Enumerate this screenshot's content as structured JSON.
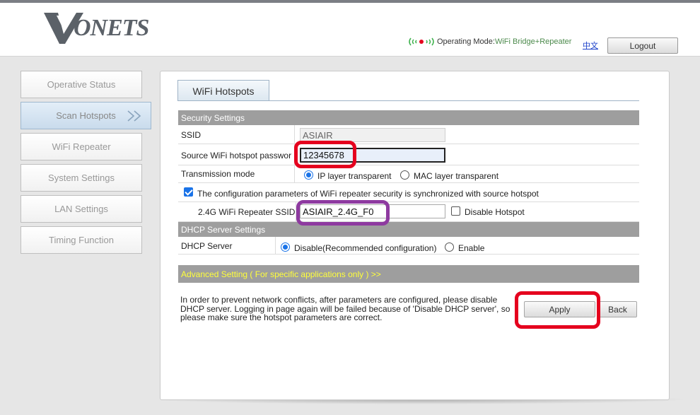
{
  "header": {
    "brand": "VONETS",
    "mode_label": "Operating Mode:",
    "mode_value": "WiFi Bridge+Repeater",
    "lang_link": "中文",
    "logout": "Logout"
  },
  "sidebar": {
    "items": [
      {
        "label": "Operative Status",
        "active": false
      },
      {
        "label": "Scan Hotspots",
        "active": true
      },
      {
        "label": "WiFi Repeater",
        "active": false
      },
      {
        "label": "System Settings",
        "active": false
      },
      {
        "label": "LAN Settings",
        "active": false
      },
      {
        "label": "Timing Function",
        "active": false
      }
    ]
  },
  "main": {
    "tab": "WiFi Hotspots",
    "security": {
      "header": "Security Settings",
      "ssid_label": "SSID",
      "ssid_value": "ASIAIR",
      "password_label": "Source WiFi hotspot passwor",
      "password_value": "12345678",
      "transmission_label": "Transmission mode",
      "transmission_options": [
        "IP layer transparent",
        "MAC layer transparent"
      ],
      "transmission_selected": "IP layer transparent",
      "sync_label": "The configuration parameters of WiFi repeater security is synchronized with source hotspot",
      "sync_checked": true,
      "repeater_ssid_label": "2.4G WiFi Repeater SSID",
      "repeater_ssid_value": "ASIAIR_2.4G_F0",
      "disable_hotspot_label": "Disable Hotspot",
      "disable_hotspot_checked": false
    },
    "dhcp": {
      "header": "DHCP Server Settings",
      "label": "DHCP Server",
      "options": [
        "Disable(Recommended configuration)",
        "Enable"
      ],
      "selected": "Disable(Recommended configuration)"
    },
    "advanced": "Advanced Setting ( For specific applications only ) >>",
    "note": "In order to prevent network conflicts, after parameters are configured, please disable DHCP server. Logging in page again will be failed because of 'Disable DHCP server', so please make sure the hotspot parameters are correct.",
    "buttons": {
      "apply": "Apply",
      "back": "Back"
    }
  },
  "colors": {
    "highlight_red": "#e5001e",
    "highlight_purple": "#8e3aa0",
    "advanced_text": "#ffff3a",
    "section_header_bg": "#9e9e9e"
  }
}
